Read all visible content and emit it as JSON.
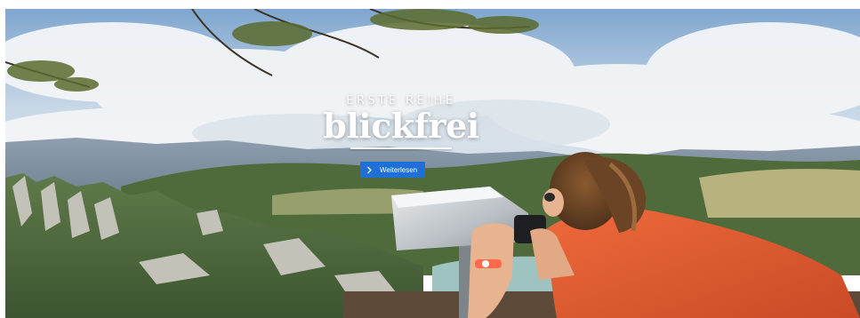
{
  "hero": {
    "eyebrow": "ERSTE REIHE",
    "headline": "blickfrei",
    "cta_label": "Weiterlesen",
    "cta_icon": "chevron-right-icon",
    "image_subject": "woman-looking-through-viewpoint-binoculars"
  },
  "colors": {
    "cta_background": "#1f6fd6",
    "text": "#ffffff",
    "sky": "#8fb2d6",
    "shirt": "#e0582f"
  }
}
